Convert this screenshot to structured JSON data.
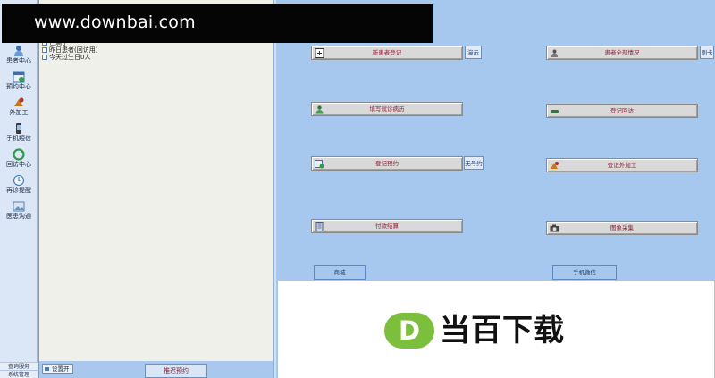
{
  "nav": {
    "items": [
      {
        "label": "患者中心",
        "icon": "patient-icon"
      },
      {
        "label": "预约中心",
        "icon": "calendar-icon"
      },
      {
        "label": "外加工",
        "icon": "outsource-icon"
      },
      {
        "label": "手机短信",
        "icon": "phone-icon"
      },
      {
        "label": "回访中心",
        "icon": "refresh-icon"
      },
      {
        "label": "再诊提醒",
        "icon": "clock-icon"
      },
      {
        "label": "医患沟通",
        "icon": "image-icon"
      }
    ],
    "bottom": [
      "查询服务",
      "系统管理"
    ]
  },
  "list": {
    "rows": [
      "已满了",
      "昨日患者(回访用)",
      "今天过生日0人"
    ],
    "expand_label": "设置开",
    "appointment_label": "推迟预约"
  },
  "main": {
    "buttons": {
      "new_patient": "新患者登记",
      "all_patients": "患者全部情况",
      "fill_record": "填写就诊病历",
      "register_visit": "登记回访",
      "register_appt": "登记预约",
      "register_outsource": "登记外加工",
      "payment": "付款结算",
      "image_capture": "图象采集"
    },
    "side": {
      "demo": "演示",
      "refresh": "刷卡",
      "no_number": "无号约"
    },
    "bottom": {
      "mall": "商城",
      "wechat": "手机微信"
    }
  },
  "watermark": {
    "top_text": "www.downbai.com",
    "logo_letter": "D",
    "bottom_text": "当百下载"
  },
  "colors": {
    "main_bg": "#a6c8ee",
    "label_red": "#8a1f35",
    "logo_green": "#7cbf3c"
  }
}
